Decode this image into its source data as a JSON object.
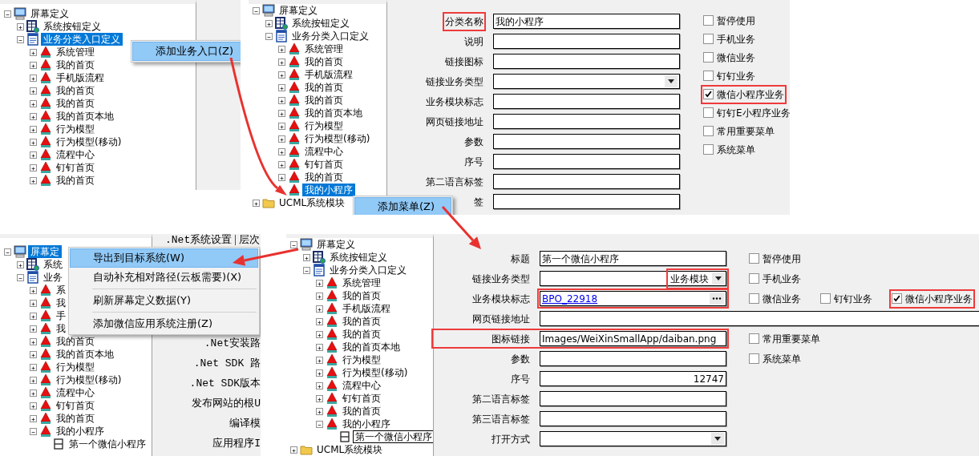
{
  "screens": [
    {
      "tree_focused": true,
      "tree": [
        {
          "label": "屏幕定义",
          "kind": "screen",
          "expanded": true,
          "selected": false,
          "children": [
            {
              "label": "系统按钮定义",
              "kind": "buttons",
              "expanded": false,
              "selected": false
            },
            {
              "label": "业务分类入口定义",
              "kind": "category",
              "expanded": true,
              "selected": true,
              "children": [
                {
                  "label": "系统管理",
                  "kind": "entry",
                  "expanded": false,
                  "selected": false
                },
                {
                  "label": "我的首页",
                  "kind": "entry",
                  "expanded": false,
                  "selected": false
                },
                {
                  "label": "手机版流程",
                  "kind": "entry",
                  "expanded": false,
                  "selected": false
                },
                {
                  "label": "我的首页",
                  "kind": "entry",
                  "expanded": false,
                  "selected": false
                },
                {
                  "label": "我的首页",
                  "kind": "entry",
                  "expanded": false,
                  "selected": false
                },
                {
                  "label": "我的首页本地",
                  "kind": "entry",
                  "expanded": false,
                  "selected": false
                },
                {
                  "label": "行为模型",
                  "kind": "entry",
                  "expanded": false,
                  "selected": false
                },
                {
                  "label": "行为模型(移动)",
                  "kind": "entry",
                  "expanded": false,
                  "selected": false
                },
                {
                  "label": "流程中心",
                  "kind": "entry",
                  "expanded": false,
                  "selected": false
                },
                {
                  "label": "钉钉首页",
                  "kind": "entry",
                  "expanded": false,
                  "selected": false
                },
                {
                  "label": "我的首页",
                  "kind": "entry",
                  "expanded": false,
                  "selected": false
                }
              ]
            }
          ]
        }
      ],
      "context_menu": [
        {
          "label": "添加业务入口(Z)",
          "selected": true,
          "divider_above": false
        }
      ]
    },
    {
      "tree_focused": true,
      "tree": [
        {
          "label": "屏幕定义",
          "kind": "screen",
          "expanded": true,
          "selected": false,
          "children": [
            {
              "label": "系统按钮定义",
              "kind": "buttons",
              "expanded": false,
              "selected": false
            },
            {
              "label": "业务分类入口定义",
              "kind": "category",
              "expanded": true,
              "selected": false,
              "children": [
                {
                  "label": "系统管理",
                  "kind": "entry",
                  "expanded": false,
                  "selected": false
                },
                {
                  "label": "我的首页",
                  "kind": "entry",
                  "expanded": false,
                  "selected": false
                },
                {
                  "label": "手机版流程",
                  "kind": "entry",
                  "expanded": false,
                  "selected": false
                },
                {
                  "label": "我的首页",
                  "kind": "entry",
                  "expanded": false,
                  "selected": false
                },
                {
                  "label": "我的首页",
                  "kind": "entry",
                  "expanded": false,
                  "selected": false
                },
                {
                  "label": "我的首页本地",
                  "kind": "entry",
                  "expanded": false,
                  "selected": false
                },
                {
                  "label": "行为模型",
                  "kind": "entry",
                  "expanded": false,
                  "selected": false
                },
                {
                  "label": "行为模型(移动)",
                  "kind": "entry",
                  "expanded": false,
                  "selected": false
                },
                {
                  "label": "流程中心",
                  "kind": "entry",
                  "expanded": false,
                  "selected": false
                },
                {
                  "label": "钉钉首页",
                  "kind": "entry",
                  "expanded": false,
                  "selected": false
                },
                {
                  "label": "我的首页",
                  "kind": "entry",
                  "expanded": false,
                  "selected": false
                },
                {
                  "label": "我的小程序",
                  "kind": "entry",
                  "selected": true
                }
              ]
            }
          ]
        },
        {
          "label": "UCML系统模块",
          "kind": "folder",
          "expanded": false,
          "selected": false
        }
      ],
      "context_menu": [
        {
          "label": "添加菜单(Z)",
          "selected": true,
          "divider_above": false
        }
      ],
      "form": {
        "rows": [
          {
            "label": "分类名称",
            "kind": "text",
            "value": "我的小程序",
            "label_highlighted": true,
            "field_highlighted": false
          },
          {
            "label": "说明",
            "kind": "text",
            "label_highlighted": false,
            "field_highlighted": false
          },
          {
            "label": "链接图标",
            "kind": "text",
            "label_highlighted": false,
            "field_highlighted": false
          },
          {
            "label": "链接业务类型",
            "kind": "dropdown",
            "label_highlighted": false,
            "field_highlighted": false
          },
          {
            "label": "业务模块标志",
            "kind": "text",
            "label_highlighted": false,
            "field_highlighted": false
          },
          {
            "label": "网页链接地址",
            "kind": "text",
            "label_highlighted": false,
            "field_highlighted": false
          },
          {
            "label": "参数",
            "kind": "text",
            "label_highlighted": false,
            "field_highlighted": false
          },
          {
            "label": "序号",
            "kind": "text",
            "label_highlighted": false,
            "field_highlighted": false
          },
          {
            "label": "第二语言标签",
            "kind": "text",
            "label_highlighted": false,
            "field_highlighted": false
          },
          {
            "label": "签",
            "kind": "text",
            "label_highlighted": false,
            "field_highlighted": false
          }
        ],
        "options": [
          {
            "label": "暂停使用",
            "checked": false,
            "highlighted": false
          },
          {
            "label": "手机业务",
            "checked": false,
            "highlighted": false
          },
          {
            "label": "微信业务",
            "checked": false,
            "highlighted": false
          },
          {
            "label": "钉钉业务",
            "checked": false,
            "highlighted": false
          },
          {
            "label": "微信小程序业务",
            "checked": true,
            "highlighted": true
          },
          {
            "label": "钉钉E小程序业务",
            "checked": false,
            "highlighted": false
          },
          {
            "label": "常用重要菜单",
            "checked": false,
            "highlighted": false
          },
          {
            "label": "系统菜单",
            "checked": false,
            "highlighted": false
          }
        ]
      }
    },
    {
      "tree_focused": true,
      "tree": [
        {
          "label": "屏幕定",
          "kind": "screen",
          "expanded": true,
          "selected": true,
          "children": [
            {
              "label": "系统",
              "kind": "buttons",
              "expanded": false,
              "selected": false
            },
            {
              "label": "业务",
              "kind": "category",
              "expanded": true,
              "selected": false,
              "children": [
                {
                  "label": "系",
                  "kind": "entry",
                  "expanded": false,
                  "selected": false
                },
                {
                  "label": "我",
                  "kind": "entry",
                  "expanded": false,
                  "selected": false
                },
                {
                  "label": "手",
                  "kind": "entry",
                  "expanded": false,
                  "selected": false
                },
                {
                  "label": "我",
                  "kind": "entry",
                  "expanded": false,
                  "selected": false
                },
                {
                  "label": "我的首页",
                  "kind": "entry",
                  "expanded": false,
                  "selected": false
                },
                {
                  "label": "我的首页本地",
                  "kind": "entry",
                  "expanded": false,
                  "selected": false
                },
                {
                  "label": "行为模型",
                  "kind": "entry",
                  "expanded": false,
                  "selected": false
                },
                {
                  "label": "行为模型(移动)",
                  "kind": "entry",
                  "expanded": false,
                  "selected": false
                },
                {
                  "label": "流程中心",
                  "kind": "entry",
                  "expanded": false,
                  "selected": false
                },
                {
                  "label": "钉钉首页",
                  "kind": "entry",
                  "expanded": false,
                  "selected": false
                },
                {
                  "label": "我的首页",
                  "kind": "entry",
                  "expanded": false,
                  "selected": false
                },
                {
                  "label": "我的小程序",
                  "kind": "entry",
                  "expanded": true,
                  "selected": false,
                  "children": [
                    {
                      "label": "第一个微信小程序",
                      "kind": "form",
                      "selected": false
                    }
                  ]
                }
              ]
            }
          ]
        }
      ],
      "context_menu": [
        {
          "label": "导出到目标系统(W)",
          "selected": true,
          "divider_above": false
        },
        {
          "label": "自动补充相对路径(云板需要)(X)",
          "selected": false,
          "divider_above": false
        },
        {
          "label": "刷新屏幕定义数据(Y)",
          "selected": false,
          "divider_above": true
        },
        {
          "label": "添加微信应用系统注册(Z)",
          "selected": false,
          "divider_above": true
        }
      ],
      "side_panel": {
        "tabs": [
          ".Net系统设置",
          "层次"
        ],
        "labels": [
          ".Net安装路",
          ".Net SDK 路",
          ".Net SDK版本",
          "发布网站的根U",
          "编译模",
          "应用程序I"
        ]
      }
    },
    {
      "tree_focused": false,
      "tree": [
        {
          "label": "屏幕定义",
          "kind": "screen",
          "expanded": true,
          "selected": false,
          "children": [
            {
              "label": "系统按钮定义",
              "kind": "buttons",
              "expanded": false,
              "selected": false
            },
            {
              "label": "业务分类入口定义",
              "kind": "category",
              "expanded": true,
              "selected": false,
              "children": [
                {
                  "label": "系统管理",
                  "kind": "entry",
                  "expanded": false,
                  "selected": false
                },
                {
                  "label": "我的首页",
                  "kind": "entry",
                  "expanded": false,
                  "selected": false
                },
                {
                  "label": "手机版流程",
                  "kind": "entry",
                  "expanded": false,
                  "selected": false
                },
                {
                  "label": "我的首页",
                  "kind": "entry",
                  "expanded": false,
                  "selected": false
                },
                {
                  "label": "我的首页",
                  "kind": "entry",
                  "expanded": false,
                  "selected": false
                },
                {
                  "label": "我的首页本地",
                  "kind": "entry",
                  "expanded": false,
                  "selected": false
                },
                {
                  "label": "行为模型",
                  "kind": "entry",
                  "expanded": false,
                  "selected": false
                },
                {
                  "label": "行为模型(移动)",
                  "kind": "entry",
                  "expanded": false,
                  "selected": false
                },
                {
                  "label": "流程中心",
                  "kind": "entry",
                  "expanded": false,
                  "selected": false
                },
                {
                  "label": "钉钉首页",
                  "kind": "entry",
                  "expanded": false,
                  "selected": false
                },
                {
                  "label": "我的首页",
                  "kind": "entry",
                  "expanded": false,
                  "selected": false
                },
                {
                  "label": "我的小程序",
                  "kind": "entry",
                  "expanded": true,
                  "selected": false,
                  "children": [
                    {
                      "label": "第一个微信小程序",
                      "kind": "form",
                      "selected": true
                    }
                  ]
                }
              ]
            }
          ]
        },
        {
          "label": "UCML系统模块",
          "kind": "folder",
          "expanded": false,
          "selected": false
        }
      ],
      "form": {
        "rows": [
          {
            "label": "标题",
            "kind": "text",
            "value": "第一个微信小程序",
            "label_highlighted": false,
            "field_highlighted": false,
            "options": [
              {
                "label": "暂停使用",
                "checked": false,
                "highlighted": false
              }
            ]
          },
          {
            "label": "链接业务类型",
            "kind": "dropdown",
            "value": "业务模块",
            "label_highlighted": false,
            "field_highlighted": true,
            "options": [
              {
                "label": "手机业务",
                "checked": false,
                "highlighted": false
              }
            ]
          },
          {
            "label": "业务模块标志",
            "kind": "lookup",
            "value": "BPO_22918",
            "label_highlighted": false,
            "field_highlighted": true,
            "options": [
              {
                "label": "微信业务",
                "checked": false,
                "highlighted": false
              },
              {
                "label": "钉钉业务",
                "checked": false,
                "highlighted": false
              },
              {
                "label": "微信小程序业务",
                "checked": true,
                "highlighted": true
              }
            ]
          },
          {
            "label": "网页链接地址",
            "kind": "text",
            "wide": true,
            "label_highlighted": false,
            "field_highlighted": false
          },
          {
            "label": "图标链接",
            "kind": "text",
            "value": "Images/WeiXinSmallApp/daiban.png",
            "label_highlighted": true,
            "field_highlighted": true,
            "options": [
              {
                "label": "常用重要菜单",
                "checked": false,
                "highlighted": false
              }
            ]
          },
          {
            "label": "参数",
            "kind": "text",
            "label_highlighted": false,
            "field_highlighted": false,
            "options": [
              {
                "label": "系统菜单",
                "checked": false,
                "highlighted": false
              }
            ]
          },
          {
            "label": "序号",
            "kind": "number",
            "value": "12747",
            "label_highlighted": false,
            "field_highlighted": false
          },
          {
            "label": "第二语言标签",
            "kind": "text",
            "label_highlighted": false,
            "field_highlighted": false
          },
          {
            "label": "第三语言标签",
            "kind": "text",
            "label_highlighted": false,
            "field_highlighted": false
          },
          {
            "label": "打开方式",
            "kind": "dropdown",
            "label_highlighted": false,
            "field_highlighted": false
          }
        ]
      }
    }
  ]
}
